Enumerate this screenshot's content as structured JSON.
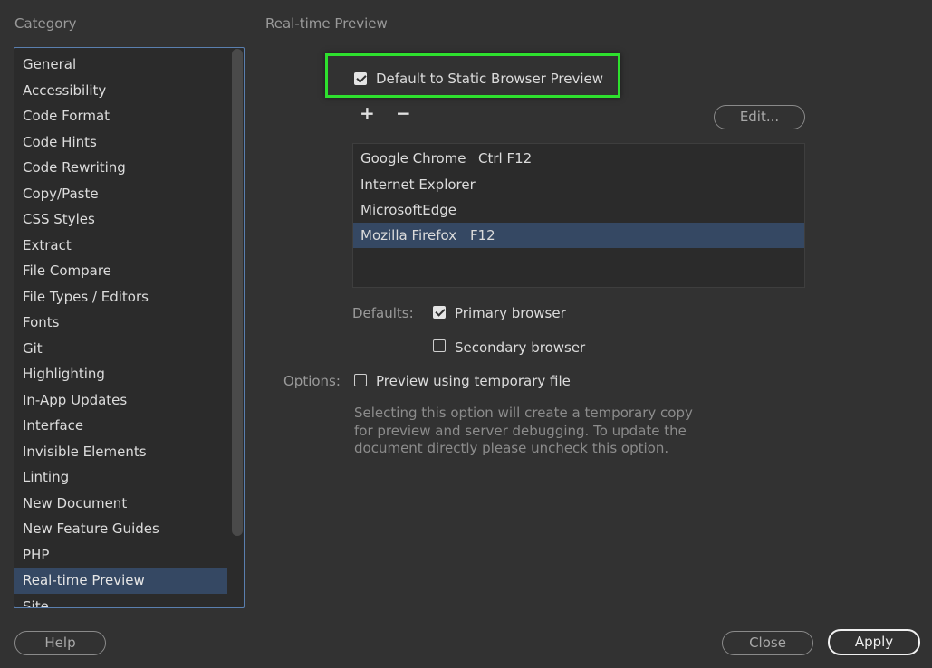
{
  "category": {
    "heading": "Category",
    "items": [
      "General",
      "Accessibility",
      "Code Format",
      "Code Hints",
      "Code Rewriting",
      "Copy/Paste",
      "CSS Styles",
      "Extract",
      "File Compare",
      "File Types / Editors",
      "Fonts",
      "Git",
      "Highlighting",
      "In-App Updates",
      "Interface",
      "Invisible Elements",
      "Linting",
      "New Document",
      "New Feature Guides",
      "PHP",
      "Real-time Preview",
      "Site"
    ],
    "selected": "Real-time Preview"
  },
  "pane": {
    "heading": "Real-time Preview",
    "default_static": {
      "label": "Default to Static Browser Preview",
      "checked": true
    },
    "add_icon": "plus-icon",
    "remove_icon": "minus-icon",
    "add_glyph": "+",
    "remove_glyph": "−",
    "edit_label": "Edit...",
    "browsers": [
      {
        "name": "Google Chrome",
        "shortcut": "Ctrl F12"
      },
      {
        "name": "Internet Explorer",
        "shortcut": ""
      },
      {
        "name": "MicrosoftEdge",
        "shortcut": ""
      },
      {
        "name": "Mozilla Firefox",
        "shortcut": "F12"
      }
    ],
    "selected_browser": "Mozilla Firefox",
    "defaults_label": "Defaults:",
    "primary_browser": {
      "label": "Primary browser",
      "checked": true
    },
    "secondary_browser": {
      "label": "Secondary browser",
      "checked": false
    },
    "options_label": "Options:",
    "temp_file": {
      "label": "Preview using temporary file",
      "checked": false
    },
    "description": "Selecting this option will create a temporary copy for preview and server debugging. To update the document directly please uncheck this option."
  },
  "footer": {
    "help_label": "Help",
    "close_label": "Close",
    "apply_label": "Apply"
  },
  "colors": {
    "background": "#323232",
    "selection": "#354863",
    "highlight": "#2ee02e",
    "list_border": "#5a7faf"
  }
}
